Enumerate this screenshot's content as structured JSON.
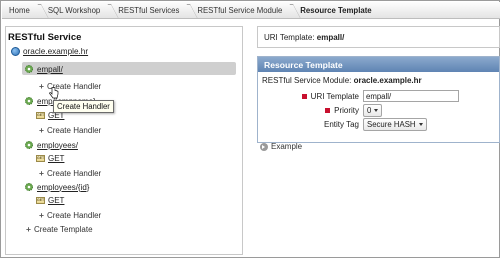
{
  "breadcrumb": [
    {
      "label": "Home"
    },
    {
      "label": "SQL Workshop"
    },
    {
      "label": "RESTful Services"
    },
    {
      "label": "RESTful Service Module"
    },
    {
      "label": "Resource Template"
    }
  ],
  "tree": {
    "title": "RESTful Service",
    "root": "oracle.example.hr",
    "templates": [
      {
        "name": "empall/",
        "selected": true,
        "handlers": [],
        "create_handler": "Create Handler"
      },
      {
        "name": "emp/{empname}",
        "handlers": [
          "GET"
        ],
        "create_handler": "Create Handler"
      },
      {
        "name": "employees/",
        "handlers": [
          "GET"
        ],
        "create_handler": "Create Handler"
      },
      {
        "name": "employees/{id}",
        "handlers": [
          "GET"
        ],
        "create_handler": "Create Handler"
      }
    ],
    "create_template": "Create Template",
    "tooltip": "Create Handler"
  },
  "uri_bar": {
    "label": "URI Template:",
    "value": "empall/"
  },
  "form": {
    "header": "Resource Template",
    "module_label": "RESTful Service Module:",
    "module_value": "oracle.example.hr",
    "uri_label": "URI Template",
    "uri_value": "empall/",
    "priority_label": "Priority",
    "priority_value": "0",
    "entity_tag_label": "Entity Tag",
    "entity_tag_value": "Secure HASH"
  },
  "example": {
    "label": "Example"
  },
  "colors": {
    "region_header": "#6f92bf",
    "required": "#c8102e",
    "selection": "#cfcfcf"
  },
  "icons": {
    "root": "globe-icon",
    "template": "gear-icon",
    "handler": "get-handler-icon",
    "example": "expand-icon"
  }
}
